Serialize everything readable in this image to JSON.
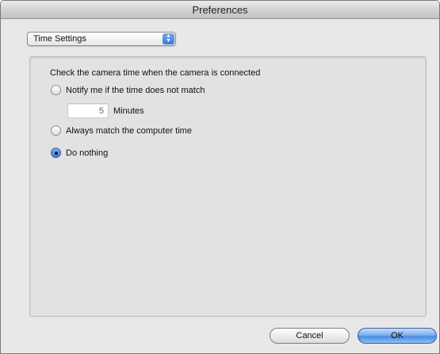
{
  "window": {
    "title": "Preferences"
  },
  "category_popup": {
    "selected": "Time Settings"
  },
  "time_check": {
    "heading": "Check the camera time when the camera is connected",
    "options": [
      {
        "label": "Notify me if the time does not match",
        "selected": false
      },
      {
        "label": "Always match the computer time",
        "selected": false
      },
      {
        "label": "Do nothing",
        "selected": true
      }
    ],
    "minutes_value": "5",
    "minutes_label": "Minutes"
  },
  "buttons": {
    "cancel": "Cancel",
    "ok": "OK"
  },
  "colors": {
    "accent": "#3a77d8",
    "window_bg": "#e8e8e8",
    "panel_bg": "#e2e2e2"
  }
}
